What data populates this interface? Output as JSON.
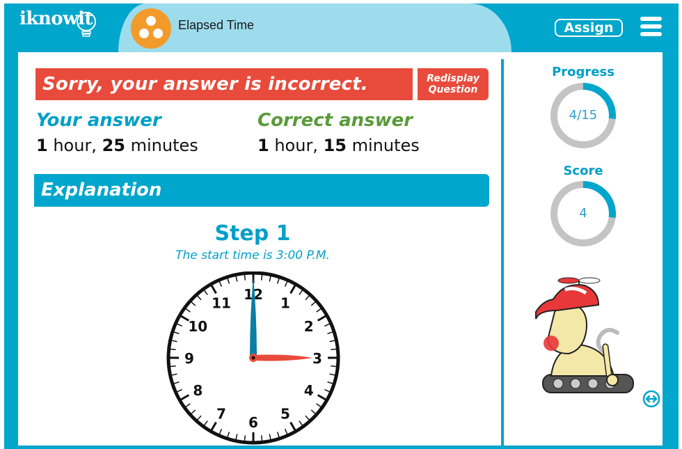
{
  "header": {
    "logo_text": "iknowit",
    "lesson_title": "Elapsed Time",
    "assign_label": "Assign",
    "menu_icon": "hamburger-menu-icon",
    "lesson_icon": "three-dots-icon"
  },
  "feedback": {
    "message": "Sorry, your answer is incorrect.",
    "redisplay_line1": "Redisplay",
    "redisplay_line2": "Question"
  },
  "answers": {
    "your_label": "Your answer",
    "your_hours": "1",
    "your_hour_word": " hour, ",
    "your_minutes": "25",
    "your_minute_word": " minutes",
    "correct_label": "Correct answer",
    "correct_hours": "1",
    "correct_hour_word": " hour, ",
    "correct_minutes": "15",
    "correct_minute_word": " minutes"
  },
  "explanation": {
    "heading": "Explanation",
    "step_title": "Step 1",
    "step_text": "The start time is 3:00 P.M.",
    "clock": {
      "hour": 3,
      "minute": 0,
      "numbers": [
        "12",
        "1",
        "2",
        "3",
        "4",
        "5",
        "6",
        "7",
        "8",
        "9",
        "10",
        "11"
      ]
    }
  },
  "sidebar": {
    "progress_label": "Progress",
    "progress_text": "4/15",
    "progress_value": 4,
    "progress_total": 15,
    "score_label": "Score",
    "score_text": "4",
    "score_fraction": 0.27
  },
  "colors": {
    "brand_blue": "#00a6cc",
    "light_blue": "#9ddcec",
    "error_red": "#e84b3c",
    "correct_green": "#5a9a3a",
    "ring_gray": "#c4c4c4",
    "orange": "#f39b2a",
    "minute_hand": "#0a7ea4"
  }
}
